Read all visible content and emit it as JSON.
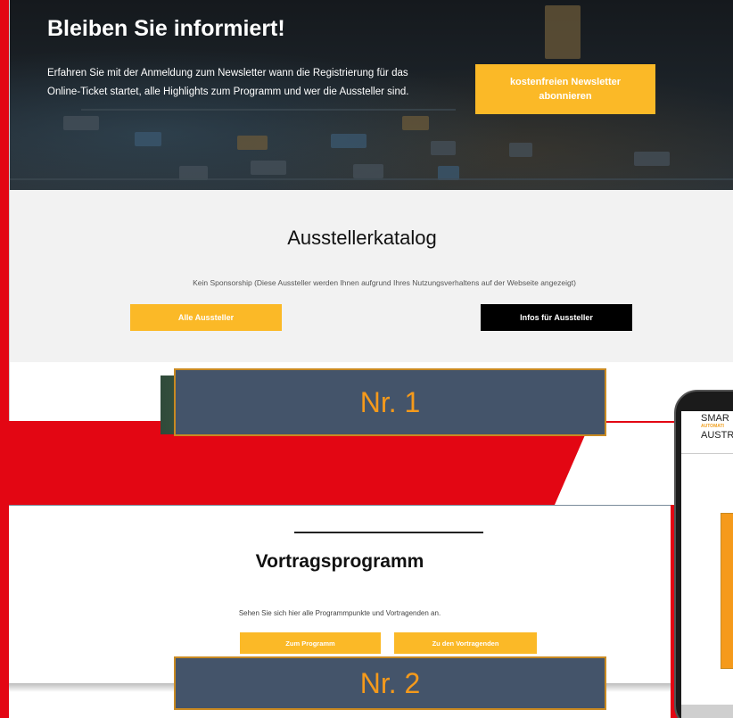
{
  "hero": {
    "title": "Bleiben Sie informiert!",
    "text": "Erfahren Sie mit der Anmeldung zum Newsletter wann die Registrierung für das Online-Ticket startet, alle Highlights zum Programm und wer die Aussteller sind.",
    "newsletter_button": "kostenfreien Newsletter abonnieren"
  },
  "catalog": {
    "title": "Ausstellerkatalog",
    "note": "Kein Sponsorship (Diese Aussteller werden Ihnen aufgrund Ihres Nutzungsverhaltens auf der Webseite angezeigt)",
    "all_exhibitors_button": "Alle Aussteller",
    "exhibitor_info_button": "Infos für Aussteller"
  },
  "labels": {
    "nr1": "Nr. 1",
    "nr2": "Nr. 2"
  },
  "program": {
    "title": "Vortragsprogramm",
    "note": "Sehen Sie sich hier alle Programmpunkte und Vortragenden an.",
    "to_program_button": "Zum Programm",
    "to_speakers_button": "Zu den Vortragenden"
  },
  "phone": {
    "logo_line1": "SMAR",
    "logo_line2": "AUTOMATI",
    "logo_line3": "AUSTR"
  },
  "colors": {
    "brand_red": "#e30613",
    "accent_yellow": "#fbb927",
    "label_box": "#44546a",
    "label_text": "#f59a1b"
  }
}
